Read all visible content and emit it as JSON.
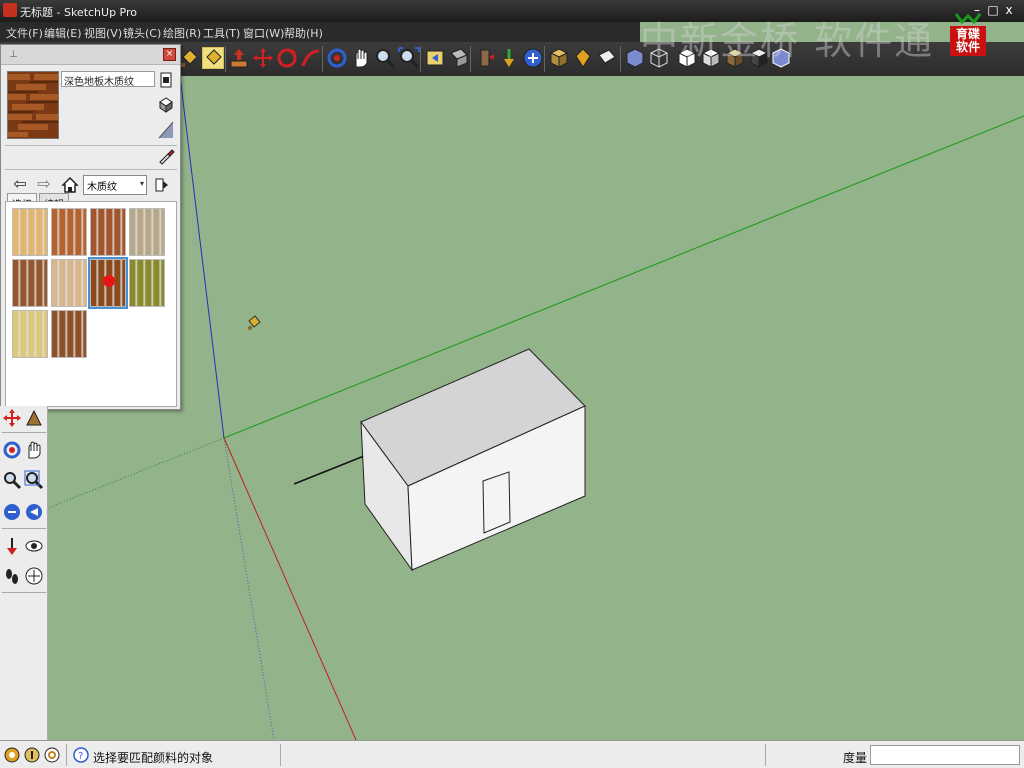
{
  "window": {
    "title": "无标题 - SketchUp Pro",
    "minimize": "–",
    "maximize": "□",
    "close": "x"
  },
  "menu": [
    "文件(F)",
    "编辑(E)",
    "视图(V)",
    "镜头(C)",
    "绘图(R)",
    "工具(T)",
    "窗口(W)",
    "帮助(H)"
  ],
  "watermark": {
    "text": "中新金桥  软件通",
    "logo_text": "育碟软件"
  },
  "material_panel": {
    "material_name": "深色地板木质纹",
    "tabs": [
      "选择",
      "编辑"
    ],
    "active_tab": 0,
    "library": "木质纹",
    "swatches": [
      {
        "name": "wood-maple",
        "color": "#e2b570"
      },
      {
        "name": "wood-cherry",
        "color": "#b4622e"
      },
      {
        "name": "wood-red",
        "color": "#a2542a"
      },
      {
        "name": "wood-grey",
        "color": "#b7a88a"
      },
      {
        "name": "wood-walnut",
        "color": "#94562c"
      },
      {
        "name": "wood-light-parquet",
        "color": "#d8b78c"
      },
      {
        "name": "wood-dark-floor",
        "color": "#8a4a1e",
        "selected": true
      },
      {
        "name": "wood-olive",
        "color": "#8a8a2c"
      },
      {
        "name": "wood-yellow",
        "color": "#dcc87a"
      },
      {
        "name": "wood-brown",
        "color": "#8e5028"
      }
    ]
  },
  "statusbar": {
    "hint": "选择要匹配颜料的对象",
    "measure_label": "度量",
    "measure_value": ""
  },
  "colors": {
    "viewport": "#93b38a",
    "accent_select": "#4a8fd6"
  }
}
